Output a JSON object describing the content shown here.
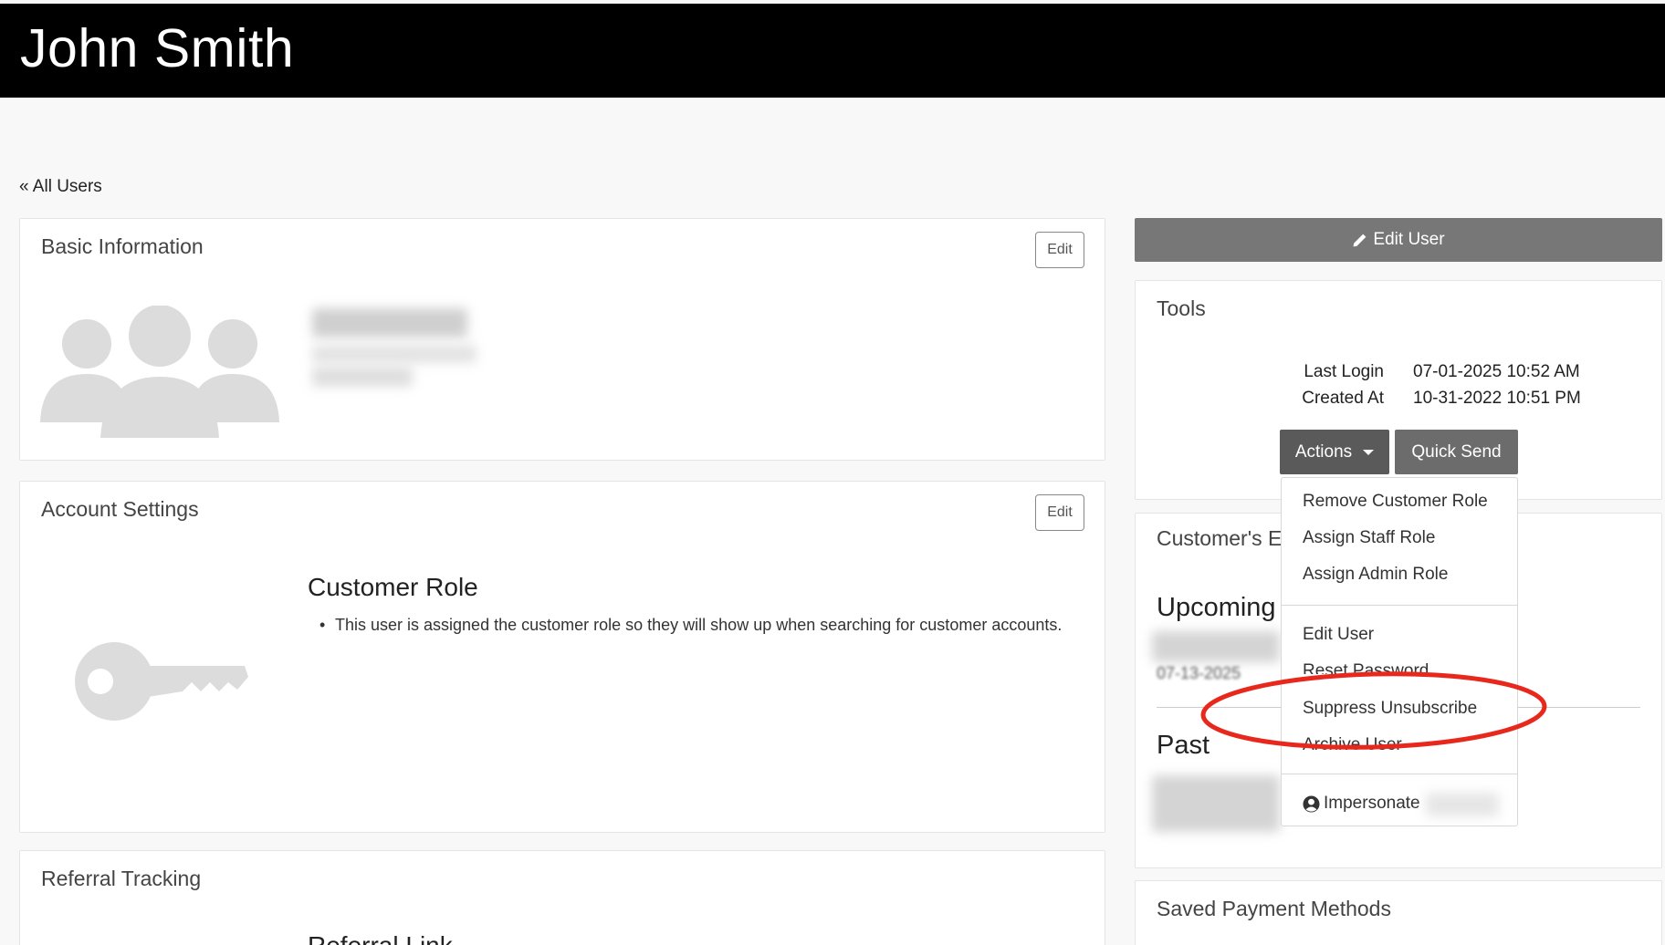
{
  "header": {
    "title": "John Smith"
  },
  "back_link": "« All Users",
  "basic_info": {
    "title": "Basic Information",
    "edit_label": "Edit"
  },
  "account_settings": {
    "title": "Account Settings",
    "edit_label": "Edit",
    "role_title": "Customer Role",
    "role_bullet": "This user is assigned the customer role so they will show up when searching for customer accounts."
  },
  "referral": {
    "title": "Referral Tracking",
    "link_label": "Referral Link"
  },
  "edit_user_button": "Edit User",
  "tools": {
    "title": "Tools",
    "last_login_label": "Last Login",
    "last_login_value": "07-01-2025 10:52 AM",
    "created_at_label": "Created At",
    "created_at_value": "10-31-2022 10:51 PM",
    "actions_label": "Actions",
    "quick_send_label": "Quick Send"
  },
  "dropdown": {
    "items": [
      "Remove Customer Role",
      "Assign Staff Role",
      "Assign Admin Role",
      "Edit User",
      "Reset Password",
      "Suppress Unsubscribe",
      "Archive User",
      "Impersonate"
    ]
  },
  "events": {
    "title_partial": "Customer's E",
    "upcoming_label": "Upcoming",
    "past_label": "Past",
    "upcoming_date_partial": "07-13-2025"
  },
  "saved_payment": {
    "title": "Saved Payment Methods"
  },
  "annotation_color": "#e8281c"
}
